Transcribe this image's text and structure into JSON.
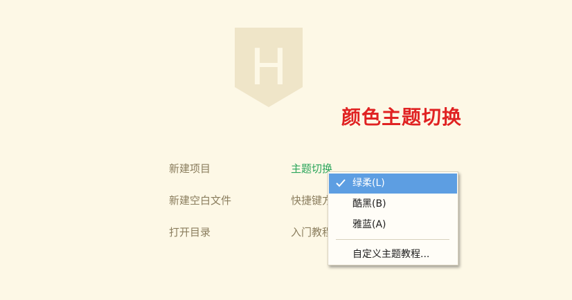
{
  "logo": {
    "letter": "H"
  },
  "annotation": {
    "title": "颜色主题切换",
    "color": "#e02222"
  },
  "menu": {
    "col1": [
      "新建项目",
      "新建空白文件",
      "打开目录"
    ],
    "col2": [
      "主题切换",
      "快捷键方",
      "入门教程"
    ]
  },
  "dropdown": {
    "items": [
      {
        "label": "绿柔(L)",
        "selected": true,
        "icon": "check-icon"
      },
      {
        "label": "酷黑(B)",
        "selected": false
      },
      {
        "label": "雅蓝(A)",
        "selected": false
      }
    ],
    "custom_label": "自定义主题教程..."
  },
  "colors": {
    "background": "#fdf8e6",
    "menu_text": "#8a7d5d",
    "active_text": "#2aa55a",
    "selection": "#5d9ee2"
  }
}
